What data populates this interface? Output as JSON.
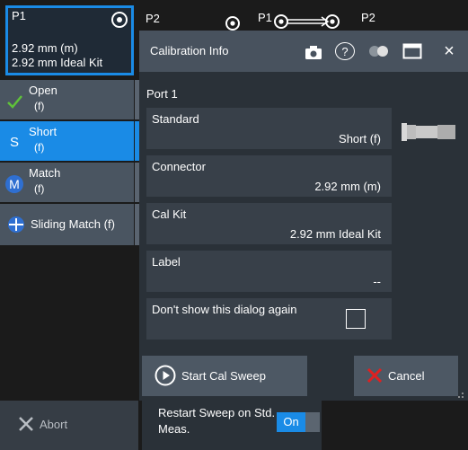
{
  "header": {
    "port1_label": "P1",
    "port2_label": "P2",
    "diagram_p1": "P1",
    "diagram_p2": "P2"
  },
  "port_card": {
    "title": "P1",
    "line1": "2.92 mm (m)",
    "line2": "2.92 mm Ideal Kit"
  },
  "standards": [
    {
      "label": "Open",
      "sub": "(f)",
      "icon": "check-icon",
      "selected": false
    },
    {
      "label": "Short",
      "sub": "(f)",
      "icon": "s-badge-icon",
      "selected": true
    },
    {
      "label": "Match",
      "sub": "(f)",
      "icon": "m-badge-icon",
      "selected": false
    },
    {
      "label": "Sliding Match (f)",
      "sub": "",
      "icon": "sliding-match-icon",
      "selected": false
    }
  ],
  "dialog": {
    "title": "Calibration Info",
    "port_title": "Port 1",
    "standard": {
      "label": "Standard",
      "value": "Short (f)"
    },
    "connector": {
      "label": "Connector",
      "value": "2.92 mm (m)"
    },
    "cal_kit": {
      "label": "Cal Kit",
      "value": "2.92 mm Ideal Kit"
    },
    "label_field": {
      "label": "Label",
      "value": "--"
    },
    "dont_show": {
      "label": "Don't show this dialog again",
      "checked": false
    },
    "start_button": "Start Cal Sweep",
    "cancel_button": "Cancel",
    "help_glyph": "?",
    "close_glyph": "×"
  },
  "footer": {
    "abort_label": "Abort",
    "restart_label_l1": "Restart Sweep on Std.",
    "restart_label_l2": "Meas.",
    "toggle_state": "On"
  },
  "colors": {
    "accent": "#1a8be6",
    "cancel_x": "#e02020",
    "check": "#5fc23a"
  }
}
